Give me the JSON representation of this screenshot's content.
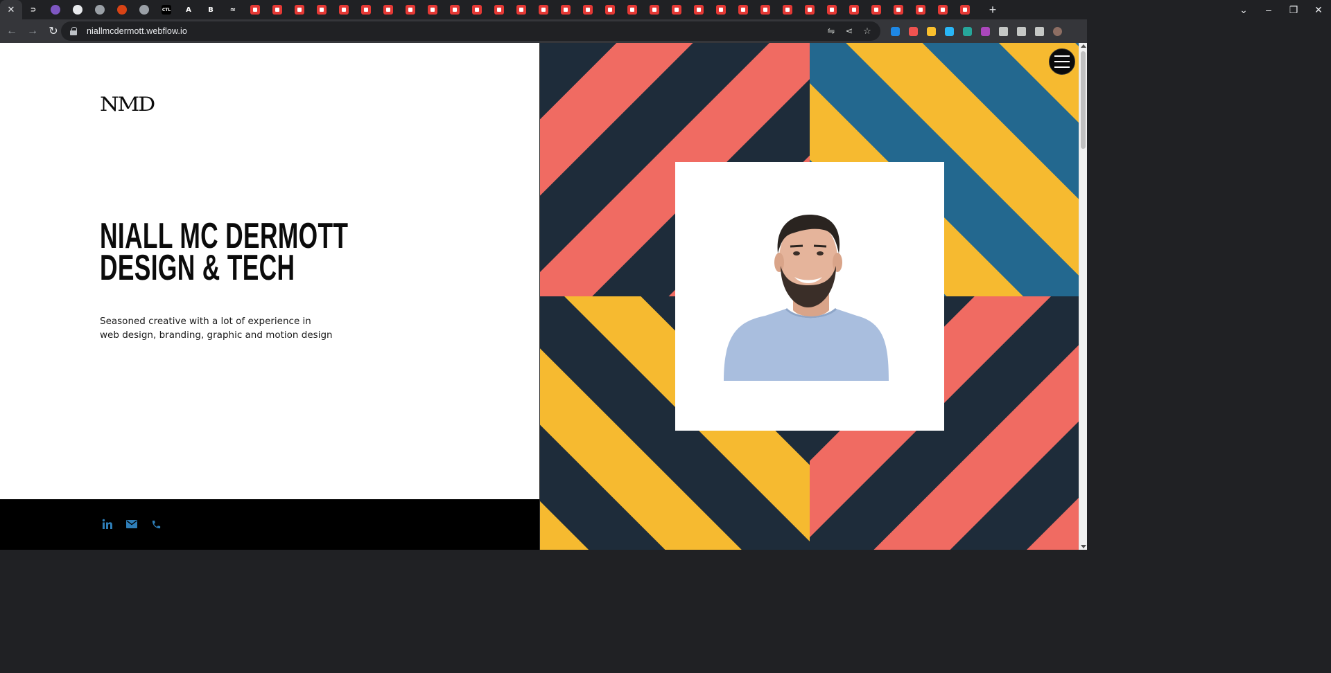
{
  "browser": {
    "url": "niallmcdermott.webflow.io",
    "tabs": [
      {
        "icon": "close-icon"
      },
      {
        "icon": "terminal-favicon",
        "glyph": "⊃"
      },
      {
        "icon": "bowl-favicon",
        "color": "#7e57c2"
      },
      {
        "icon": "cloud-favicon",
        "color": "#e8eaed"
      },
      {
        "icon": "globe-favicon",
        "color": "#9aa0a6"
      },
      {
        "icon": "badge-favicon",
        "color": "#d84315"
      },
      {
        "icon": "globe-favicon",
        "color": "#9aa0a6"
      },
      {
        "icon": "ctl-favicon",
        "glyph": "CTL"
      },
      {
        "icon": "ap-favicon",
        "glyph": "A"
      },
      {
        "icon": "b-favicon",
        "glyph": "B"
      },
      {
        "icon": "wave-favicon",
        "glyph": "≈"
      }
    ],
    "red_tab_count": 33,
    "new_tab_label": "+",
    "extension_colors": [
      "#1e88e5",
      "#ef5350",
      "#fbc02d",
      "#29b6f6",
      "#26a69a",
      "#ab47bc"
    ]
  },
  "page": {
    "logo": "NMD",
    "hero_lines": [
      "NIALL MC DERMOTT",
      "DESIGN & TECH"
    ],
    "description_lines": [
      "Seasoned creative with a lot of experience in",
      "web design, branding, graphic and motion design"
    ],
    "social": [
      {
        "name": "linkedin-icon",
        "glyph": "in"
      },
      {
        "name": "email-icon"
      },
      {
        "name": "phone-icon"
      }
    ],
    "colors": {
      "salmon": "#F06B62",
      "navy": "#1E2C3A",
      "yellow": "#F6BA30",
      "blue": "#23688F",
      "accent": "#2E7EB8"
    }
  }
}
